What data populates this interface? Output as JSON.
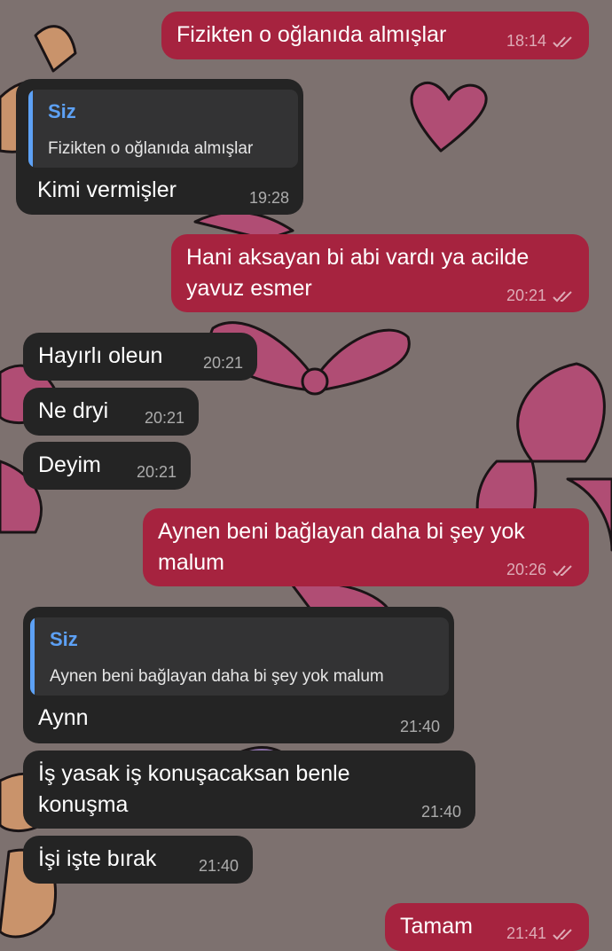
{
  "chat": {
    "messages": [
      {
        "id": "m1",
        "direction": "outgoing",
        "text": "Fizikten o oğlanıda almışlar",
        "time": "18:14"
      },
      {
        "id": "m2",
        "direction": "incoming",
        "reply_to": {
          "name": "Siz",
          "text": "Fizikten o oğlanıda almışlar"
        },
        "text": "Kimi vermişler",
        "time": "19:28"
      },
      {
        "id": "m3",
        "direction": "outgoing",
        "text_lines": [
          "Hani aksayan bi abi vardı ya acilde",
          "yavuz esmer"
        ],
        "time": "20:21"
      },
      {
        "id": "m4",
        "direction": "incoming",
        "text": "Hayırlı oleun",
        "time": "20:21"
      },
      {
        "id": "m5",
        "direction": "incoming",
        "text": "Ne dryi",
        "time": "20:21"
      },
      {
        "id": "m6",
        "direction": "incoming",
        "text": "Deyim",
        "time": "20:21"
      },
      {
        "id": "m7",
        "direction": "outgoing",
        "text_lines": [
          "Aynen beni bağlayan daha bi şey yok",
          "malum"
        ],
        "time": "20:26"
      },
      {
        "id": "m8",
        "direction": "incoming",
        "reply_to": {
          "name": "Siz",
          "text": "Aynen beni bağlayan daha bi şey yok malum"
        },
        "text": "Aynn",
        "time": "21:40"
      },
      {
        "id": "m9",
        "direction": "incoming",
        "text_lines": [
          "İş yasak iş konuşacaksan benle",
          "konuşma"
        ],
        "time": "21:40"
      },
      {
        "id": "m10",
        "direction": "incoming",
        "text": "İşi işte bırak",
        "time": "21:40"
      },
      {
        "id": "m11",
        "direction": "outgoing",
        "text": "Tamam",
        "time": "21:41"
      }
    ]
  },
  "colors": {
    "background": "#7d716f",
    "outgoing_bubble": "#a6233f",
    "incoming_bubble": "#242424",
    "reply_accent": "#5da1f5"
  },
  "icons": {
    "read_status": "double-check-icon",
    "wallpaper": "bows-and-hearts-pattern"
  }
}
